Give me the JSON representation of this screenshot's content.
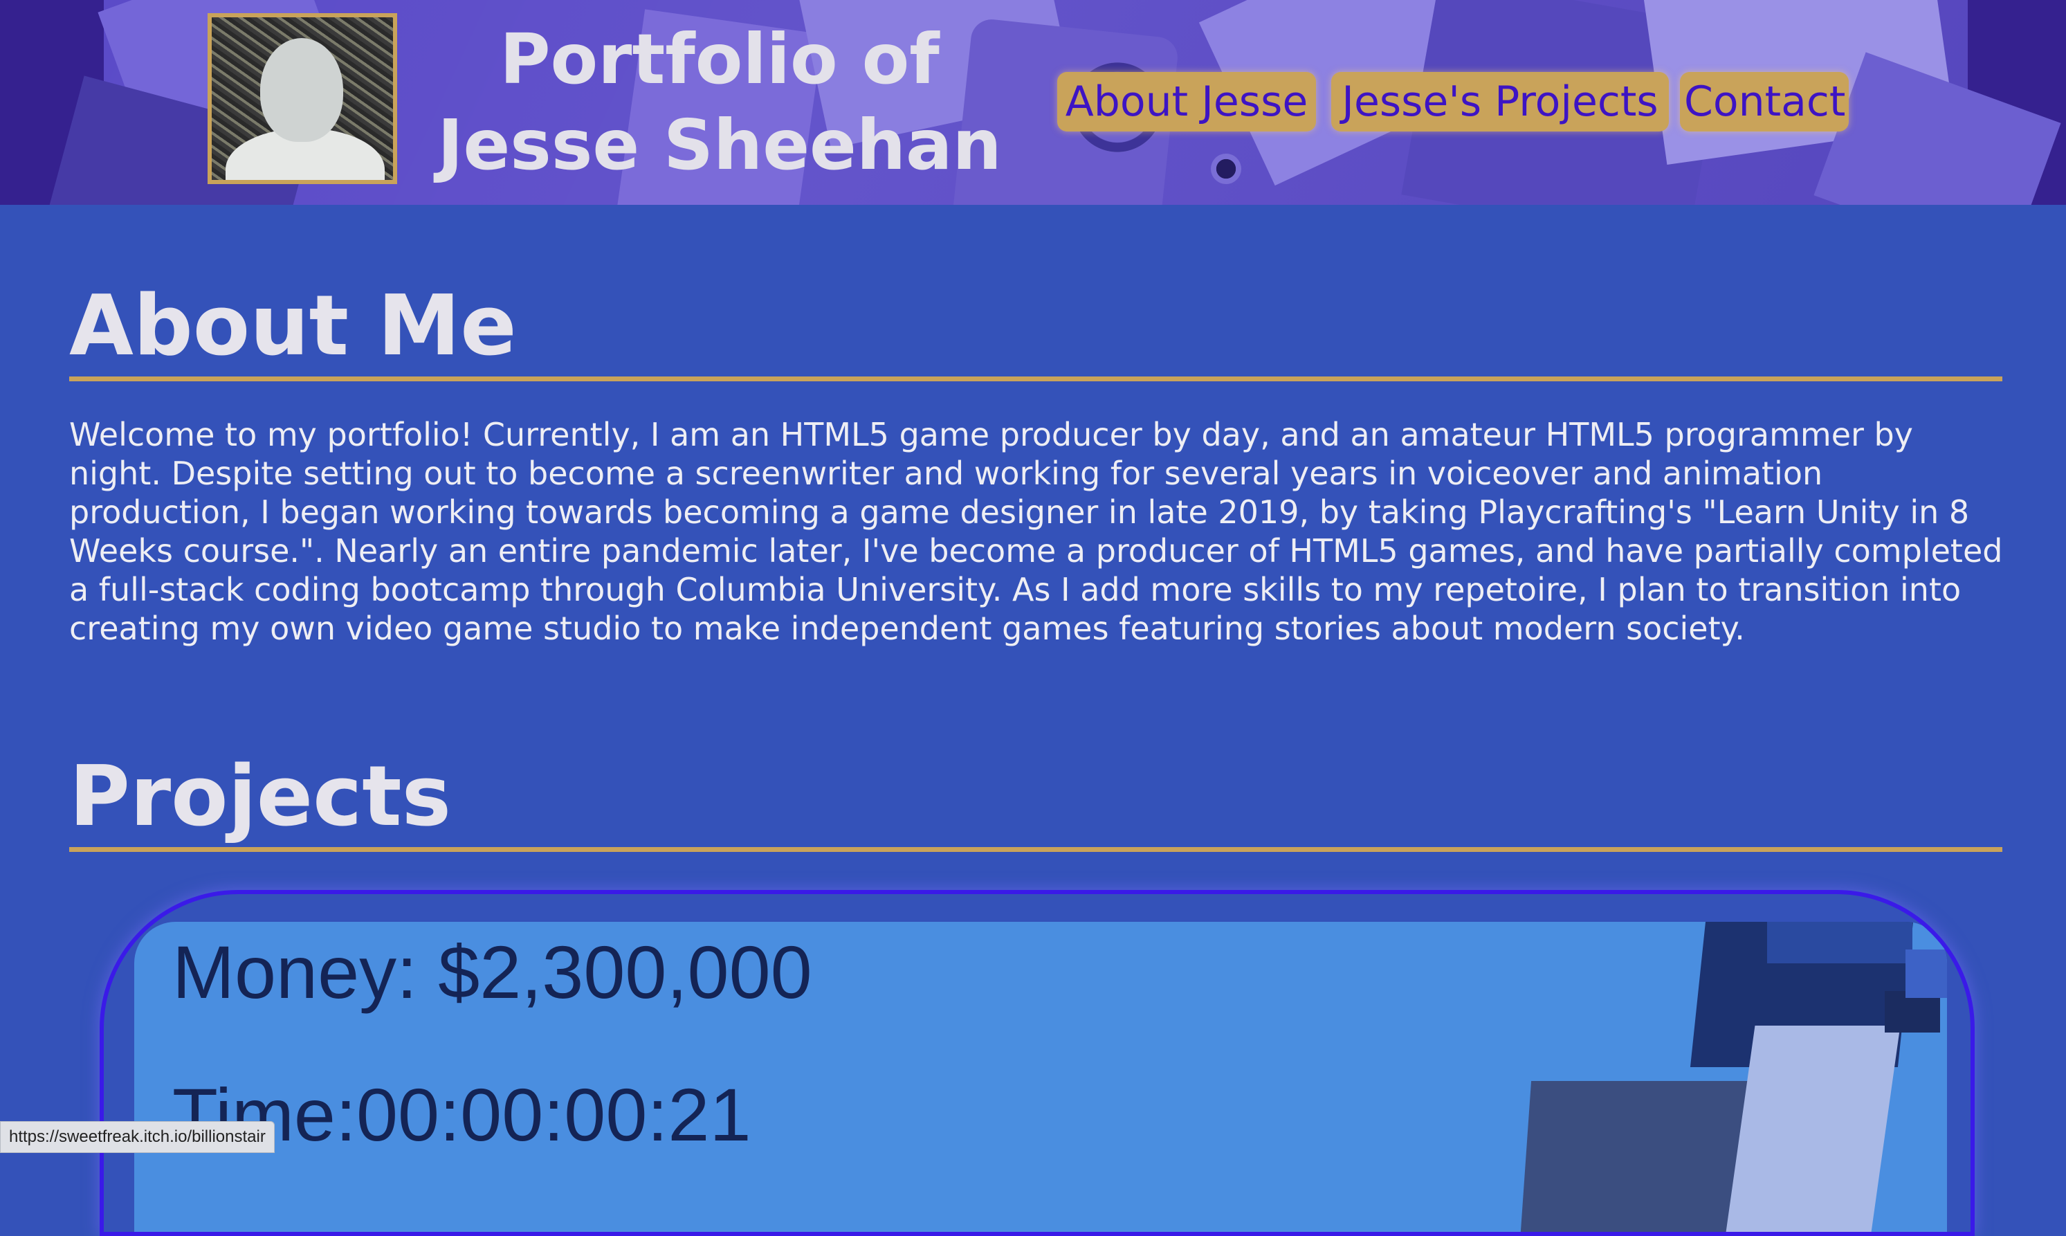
{
  "header": {
    "title_line1": "Portfolio of",
    "title_line2": "Jesse Sheehan",
    "nav": {
      "about": "About Jesse",
      "projects": "Jesse's Projects",
      "contact": "Contact"
    }
  },
  "about": {
    "heading": "About Me",
    "text": "Welcome to my portfolio! Currently, I am an HTML5 game producer by day, and an amateur HTML5 programmer by night. Despite setting out to become a screenwriter and working for several years in voiceover and animation production, I began working towards becoming a game designer in late 2019, by taking Playcrafting's \"Learn Unity in 8 Weeks course.\". Nearly an entire pandemic later, I've become a producer of HTML5 games, and have partially completed a full-stack coding bootcamp through Columbia University. As I add more skills to my repetoire, I plan to transition into creating my own video game studio to make independent games featuring stories about modern society."
  },
  "projects": {
    "heading": "Projects",
    "card": {
      "money": "Money: $2,300,000",
      "time": "Time:00:00:00:21"
    }
  },
  "statusbar": {
    "url": "https://sweetfreak.itch.io/billionstair"
  },
  "colors": {
    "page_bg": "#3452b9",
    "accent_gold": "#c9a35a",
    "nav_text": "#3d14c4",
    "card_border": "#3a1ae8"
  },
  "icons": {
    "avatar": "profile-photo"
  }
}
